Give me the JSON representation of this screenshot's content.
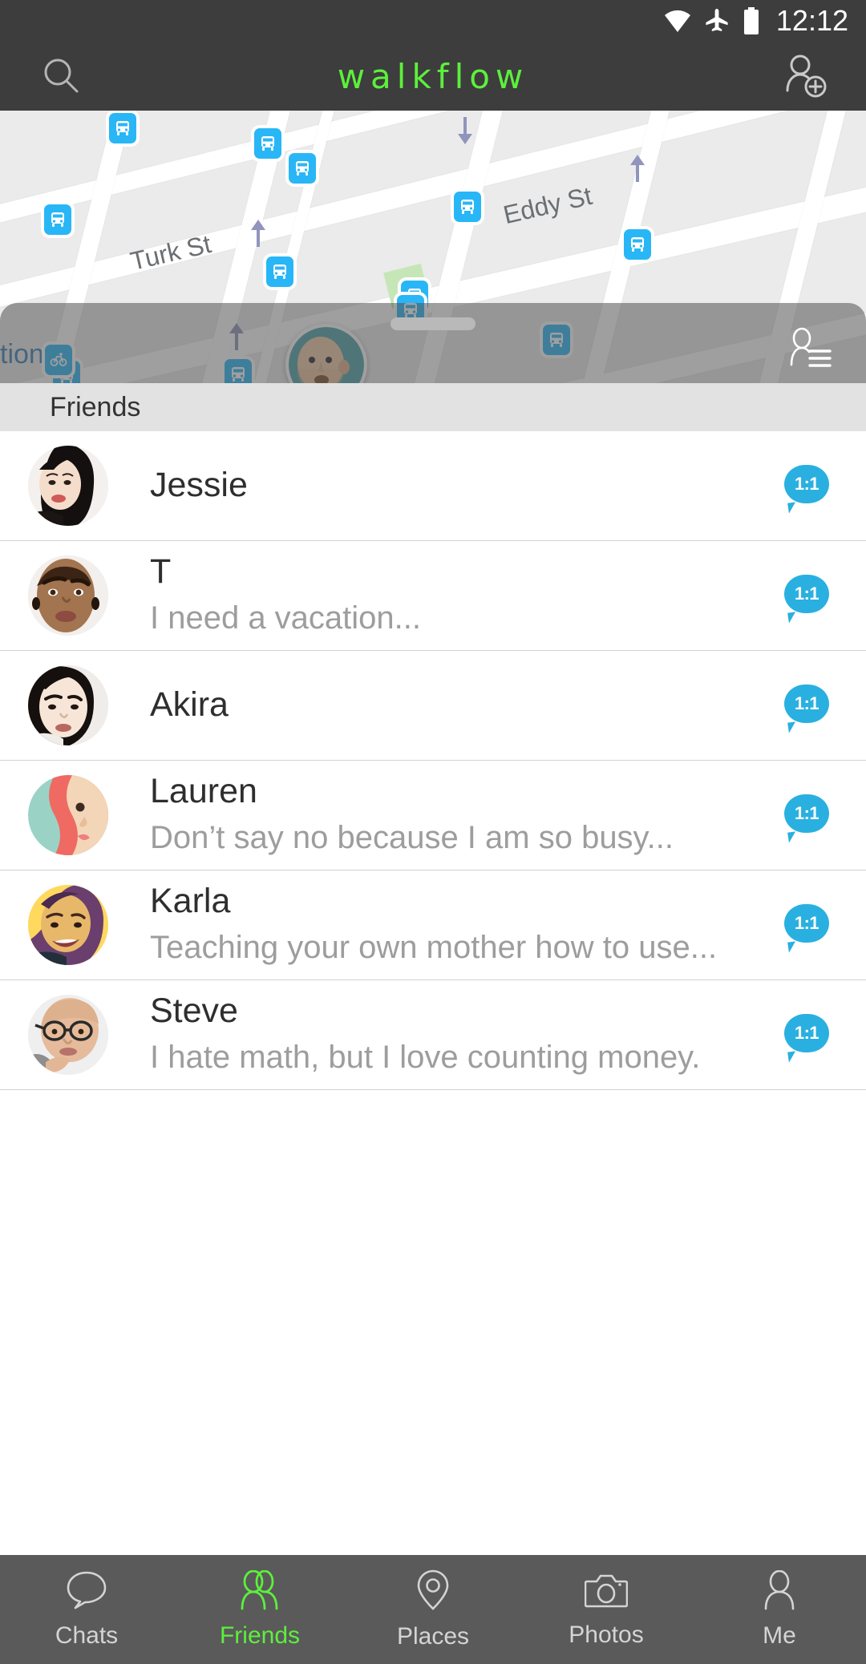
{
  "status_bar": {
    "time": "12:12",
    "icons": [
      "wifi-icon",
      "airplane-mode-icon",
      "battery-icon"
    ]
  },
  "app_bar": {
    "brand": "walkflow",
    "brand_color": "#5cf03c",
    "search_icon": "search-icon",
    "add_friend_icon": "add-person-icon"
  },
  "map": {
    "street_labels": [
      {
        "text": "Turk St"
      },
      {
        "text": "Eddy St"
      },
      {
        "text": "tion"
      }
    ],
    "markers": {
      "bus_icon": "bus-stop-icon",
      "bike_icon": "bike-share-icon"
    },
    "user_avatar": "user-location-avatar"
  },
  "sheet": {
    "drag_handle": "drag-handle",
    "roster_icon": "person-list-icon"
  },
  "friends_section": {
    "header": "Friends",
    "items": [
      {
        "name": "Jessie",
        "subtitle": "",
        "badge": "1:1",
        "avatar": "photo-jessie"
      },
      {
        "name": "T",
        "subtitle": "I need a vacation...",
        "badge": "1:1",
        "avatar": "photo-t"
      },
      {
        "name": "Akira",
        "subtitle": "",
        "badge": "1:1",
        "avatar": "photo-akira"
      },
      {
        "name": "Lauren",
        "subtitle": "Don’t say no because I am so busy...",
        "badge": "1:1",
        "avatar": "illustration-lauren"
      },
      {
        "name": "Karla",
        "subtitle": "Teaching your own mother how to use...",
        "badge": "1:1",
        "avatar": "photo-karla"
      },
      {
        "name": "Steve",
        "subtitle": "I hate math, but I love counting money.",
        "badge": "1:1",
        "avatar": "photo-steve"
      }
    ]
  },
  "bottom_nav": {
    "active_index": 1,
    "active_color": "#5cf03c",
    "items": [
      {
        "label": "Chats",
        "icon": "chat-bubble-icon"
      },
      {
        "label": "Friends",
        "icon": "two-people-icon"
      },
      {
        "label": "Places",
        "icon": "map-pin-icon"
      },
      {
        "label": "Photos",
        "icon": "camera-icon"
      },
      {
        "label": "Me",
        "icon": "person-icon"
      }
    ]
  },
  "colors": {
    "chrome": "#3d3d3d",
    "accent_green": "#5cf03c",
    "badge_blue": "#29b0e0",
    "marker_blue": "#29b6f6",
    "nav_bar": "#5a5a5a"
  }
}
